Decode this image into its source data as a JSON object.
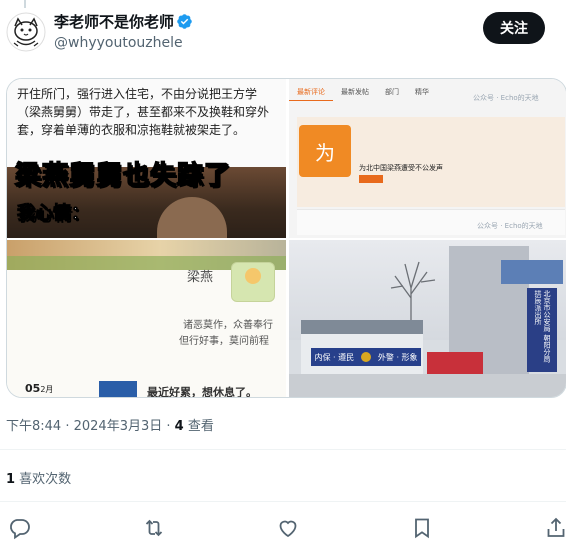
{
  "user": {
    "display_name": "李老师不是你老师",
    "handle": "@whyyoutouzhele",
    "verified": true,
    "avatar_icon": "cat-sketch-avatar",
    "follow_label": "关注"
  },
  "media": {
    "tile1": {
      "text": "开住所门，强行进入住宅，不由分说把王方学（梁燕舅舅）带走了，甚至都来不及换鞋和穿外套，穿着单薄的衣服和凉拖鞋就被架走了。",
      "meme_line1": "梁燕舅舅也失踪了",
      "meme_line2": "我心情："
    },
    "tile2": {
      "tabs": [
        "最新评论",
        "最新发帖",
        "部门",
        "精华"
      ],
      "watermark_top": "公众号 · Echo的天地",
      "watermark_bottom": "公众号 · Echo的天地",
      "icon_char": "为",
      "title": "为北中国梁燕遭受不公发声"
    },
    "tile3": {
      "name": "梁燕",
      "poem_line1": "诸恶莫作，众善奉行",
      "poem_line2": "但行好事，莫问前程",
      "date": "05",
      "date_suffix": "2月",
      "footer": "最近好累，想休息了。"
    },
    "tile4": {
      "sign_left": "内保 · 遵民",
      "sign_right": "外警 · 形象",
      "vertical_sign": "北京市公安局 朝阳分局 拱辰派出所"
    }
  },
  "meta": {
    "time": "下午8:44",
    "dot1": " · ",
    "date": "2024年3月3日",
    "dot2": " · ",
    "views_count": "4",
    "views_label": " 查看"
  },
  "likes": {
    "count": "1",
    "label": " 喜欢次数"
  },
  "actions": {
    "icons": [
      "reply-icon",
      "retweet-icon",
      "like-icon",
      "bookmark-icon",
      "share-icon"
    ]
  },
  "colors": {
    "text_primary": "#0f1419",
    "text_secondary": "#536471",
    "verified_blue": "#1d9bf0",
    "divider": "#eff3f4"
  }
}
